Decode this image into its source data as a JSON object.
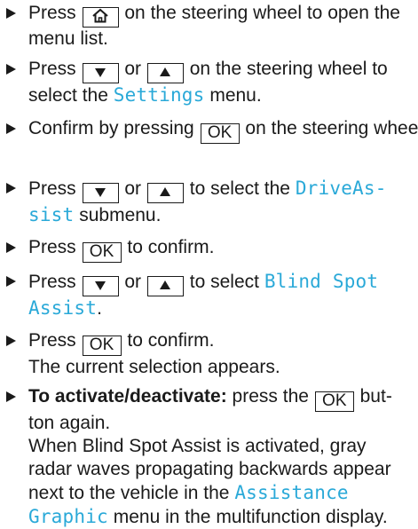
{
  "steps": [
    {
      "pre": "Press",
      "post": "on the steering wheel to open the menu list.",
      "key_icon": "home-icon"
    },
    {
      "pre": "Press",
      "or": "or",
      "mid": "on the steering wheel to select the",
      "menu": "Settings",
      "post": "menu.",
      "key_icons": [
        "down-triangle-icon",
        "up-triangle-icon"
      ]
    },
    {
      "pre": "Confirm by pressing",
      "key": "OK",
      "post": "on the steering wheel."
    },
    {
      "pre": "Press",
      "or": "or",
      "mid": "to select the",
      "menu_a": "DriveAs-",
      "menu_b": "sist",
      "post": "submenu."
    },
    {
      "pre": "Press",
      "key": "OK",
      "post": "to confirm."
    },
    {
      "pre": "Press",
      "or": "or",
      "mid": "to select",
      "menu_a": "Blind Spot",
      "menu_b": "Assist",
      "post": "."
    },
    {
      "pre": "Press",
      "key": "OK",
      "post": "to confirm.",
      "note": "The current selection appears."
    },
    {
      "bold": "To activate/deactivate:",
      "pre": "press the",
      "key": "OK",
      "post_a": "but-",
      "post_b": "ton again.",
      "note_a": "When Blind Spot Assist is activated, gray",
      "note_b": "radar waves propagating backwards appear",
      "note_c": "next to the vehicle in the",
      "menu_a": "Assistance",
      "menu_b": "Graphic",
      "note_d": "menu in the multifunction display."
    }
  ],
  "colors": {
    "menu_text": "#2aa9d8",
    "body_text": "#1a1a1a"
  }
}
